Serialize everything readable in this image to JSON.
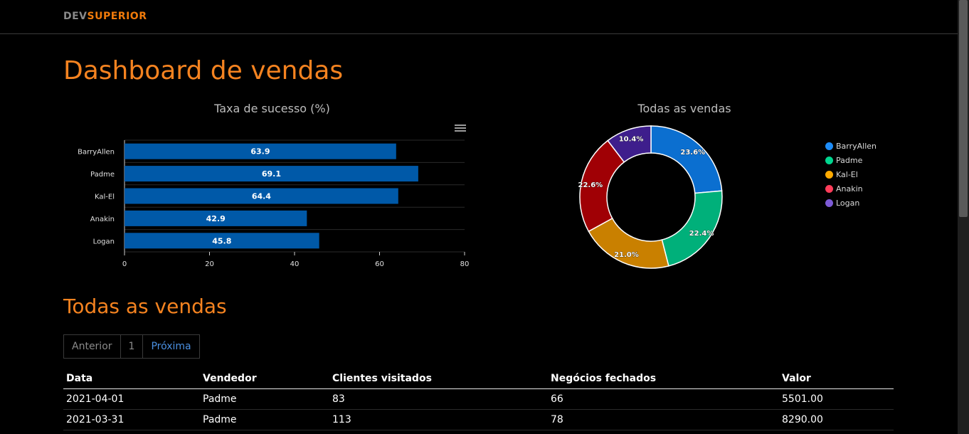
{
  "brand": {
    "prefix": "DEV",
    "suffix": "SUPERIOR"
  },
  "page_title": "Dashboard de vendas",
  "charts": {
    "bar_title": "Taxa de sucesso (%)",
    "donut_title": "Todas as vendas"
  },
  "chart_data": [
    {
      "type": "bar",
      "orientation": "horizontal",
      "title": "Taxa de sucesso (%)",
      "categories": [
        "BarryAllen",
        "Padme",
        "Kal-El",
        "Anakin",
        "Logan"
      ],
      "values": [
        63.9,
        69.1,
        64.4,
        42.9,
        45.8
      ],
      "xlim": [
        0,
        80
      ],
      "xticks": [
        "0",
        "20",
        "40",
        "60",
        "80"
      ],
      "color": "#0059a8",
      "grid": true
    },
    {
      "type": "pie",
      "variant": "donut",
      "title": "Todas as vendas",
      "labels": [
        "BarryAllen",
        "Padme",
        "Kal-El",
        "Anakin",
        "Logan"
      ],
      "values": [
        23.6,
        22.4,
        21.0,
        22.6,
        10.4
      ],
      "value_labels": [
        "23.6%",
        "22.4%",
        "21.0%",
        "22.6%",
        "10.4%"
      ],
      "colors": [
        "#0b6fd0",
        "#00b07a",
        "#c98000",
        "#a00005",
        "#3e1e8c"
      ],
      "legend_colors": [
        "#1d8cf8",
        "#00d68f",
        "#ffaa00",
        "#ff3d5a",
        "#7d5bd6"
      ],
      "legend": "right"
    }
  ],
  "sales_section": {
    "title": "Todas as vendas",
    "pagination": {
      "prev": "Anterior",
      "page": "1",
      "next": "Próxima"
    },
    "columns": [
      "Data",
      "Vendedor",
      "Clientes visitados",
      "Negócios fechados",
      "Valor"
    ],
    "rows": [
      [
        "2021-04-01",
        "Padme",
        "83",
        "66",
        "5501.00"
      ],
      [
        "2021-03-31",
        "Padme",
        "113",
        "78",
        "8290.00"
      ]
    ]
  },
  "icons": {
    "chart_menu": "hamburger-menu-icon"
  }
}
